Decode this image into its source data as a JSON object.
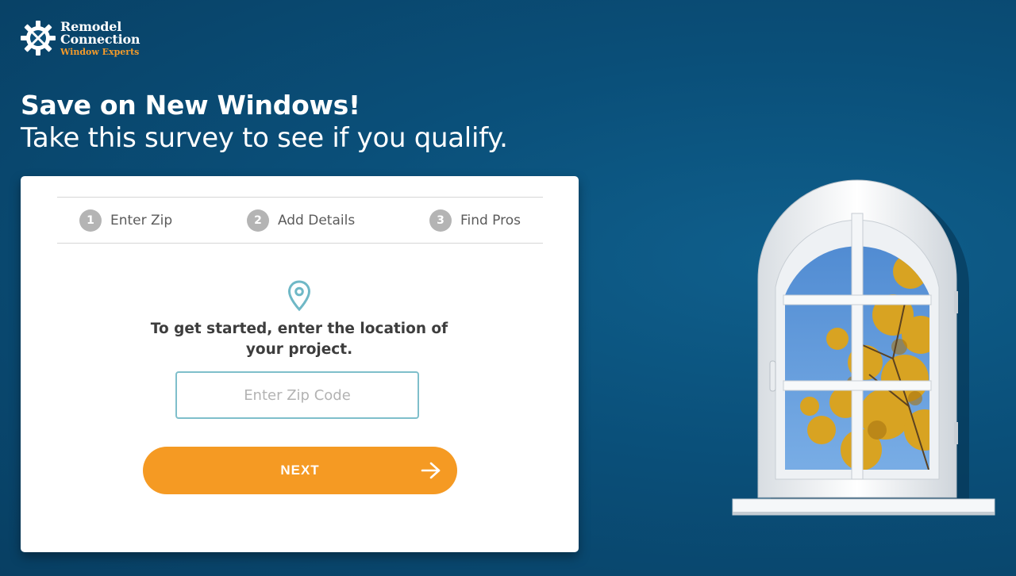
{
  "brand": {
    "line1": "Remodel",
    "line2": "Connection",
    "line3": "Window Experts",
    "accent_color": "#f39a2a"
  },
  "hero": {
    "title": "Save on New Windows!",
    "subtitle": "Take this survey to see if you qualify."
  },
  "steps": [
    {
      "number": "1",
      "label": "Enter Zip"
    },
    {
      "number": "2",
      "label": "Add Details"
    },
    {
      "number": "3",
      "label": "Find Pros"
    }
  ],
  "form": {
    "prompt": "To get started, enter the location of your project.",
    "zip_placeholder": "Enter Zip Code",
    "zip_value": "",
    "next_label": "NEXT",
    "button_color": "#f59a23",
    "input_border_color": "#7fbfcb"
  },
  "icons": {
    "logo": "gear-wrench-icon",
    "location": "location-pin-icon",
    "next": "arrow-right-icon",
    "illustration": "arched-window-illustration"
  }
}
